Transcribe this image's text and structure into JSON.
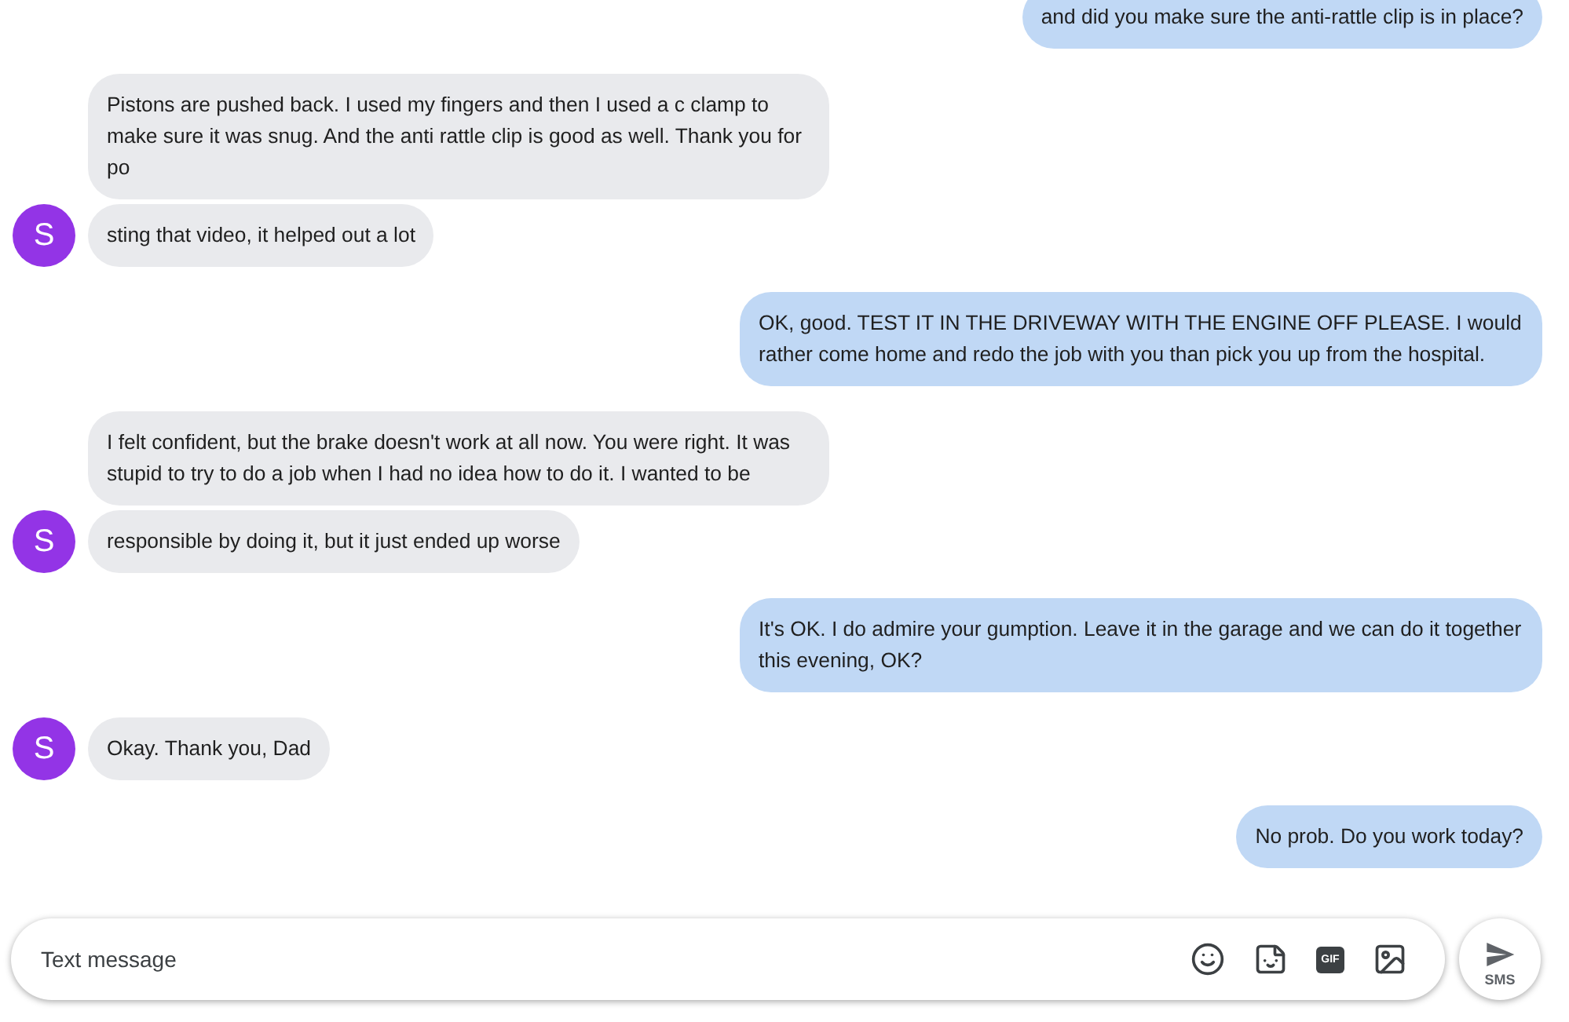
{
  "conversation": [
    {
      "kind": "sent",
      "bubbles": [
        "and did you make sure the anti-rattle clip is in place?"
      ]
    },
    {
      "kind": "received",
      "avatar": "S",
      "bubbles": [
        "Pistons are pushed back. I used my fingers and then I used a c clamp to make sure it was snug. And the anti rattle clip is good as well. Thank you for po",
        "sting that video, it helped out a lot"
      ]
    },
    {
      "kind": "sent",
      "bubbles": [
        "OK, good. TEST IT IN THE DRIVEWAY WITH THE ENGINE OFF PLEASE. I would rather come home and redo the job with you than pick you up from the hospital."
      ]
    },
    {
      "kind": "received",
      "avatar": "S",
      "bubbles": [
        "I felt confident, but the brake doesn't work at all now. You were right. It was stupid to try to do a job when I had no idea how to do it. I wanted to be",
        " responsible by doing it, but it just ended up worse"
      ]
    },
    {
      "kind": "sent",
      "bubbles": [
        "It's OK. I do admire your gumption. Leave it in the garage and we can do it together this evening, OK?"
      ]
    },
    {
      "kind": "received",
      "avatar": "S",
      "bubbles": [
        "Okay. Thank you, Dad"
      ]
    },
    {
      "kind": "sent",
      "bubbles": [
        "No prob. Do you work today?"
      ]
    }
  ],
  "composer": {
    "placeholder": "Text message",
    "gif_label": "GIF",
    "send_label": "SMS"
  }
}
